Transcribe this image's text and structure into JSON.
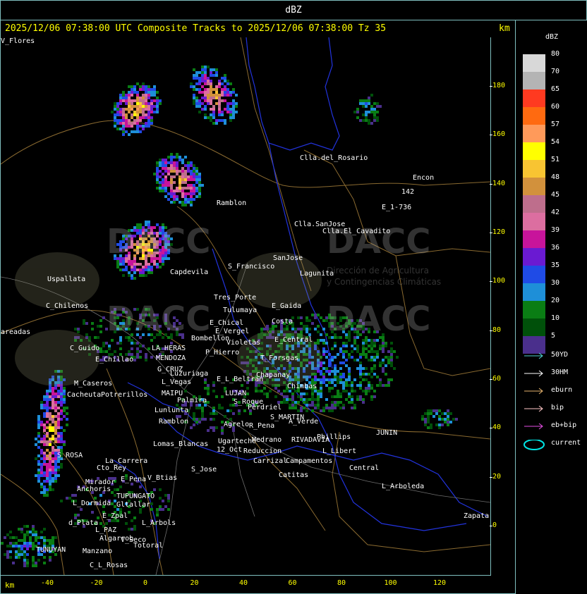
{
  "window_title": "dBZ",
  "header": {
    "info": "2025/12/06 07:38:00 UTC Composite Tracks to 2025/12/06 07:38:00 Tz 35",
    "km_label": "km"
  },
  "legend": {
    "title": "dBZ",
    "entries": [
      {
        "label": "80",
        "color": "#d8d8d8"
      },
      {
        "label": "70",
        "color": "#b4b4b4"
      },
      {
        "label": "65",
        "color": "#ff3a20"
      },
      {
        "label": "60",
        "color": "#ff6a10"
      },
      {
        "label": "57",
        "color": "#ff9a5a"
      },
      {
        "label": "54",
        "color": "#ffff00"
      },
      {
        "label": "51",
        "color": "#f8c432"
      },
      {
        "label": "48",
        "color": "#d2913c"
      },
      {
        "label": "45",
        "color": "#be6e8c"
      },
      {
        "label": "42",
        "color": "#dc6ea0"
      },
      {
        "label": "39",
        "color": "#c8149b"
      },
      {
        "label": "36",
        "color": "#6a1ad2"
      },
      {
        "label": "35",
        "color": "#1f4be6"
      },
      {
        "label": "30",
        "color": "#1e8fd8"
      },
      {
        "label": "20",
        "color": "#0a7d14"
      },
      {
        "label": "10",
        "color": "#00500a"
      },
      {
        "label": "5",
        "color": "#4a2f8c"
      }
    ],
    "tracks": [
      {
        "label": "50YD",
        "color": "#4fd2d2"
      },
      {
        "label": "30HM",
        "color": "#ffffff"
      },
      {
        "label": "eburn",
        "color": "#e6b46e"
      },
      {
        "label": "bip",
        "color": "#ffc8c8"
      },
      {
        "label": "eb+bip",
        "color": "#e650e6"
      },
      {
        "label": "current",
        "color": "#00e6e6"
      }
    ]
  },
  "axes": {
    "y_ticks": [
      "180",
      "160",
      "140",
      "120",
      "100",
      "80",
      "60",
      "40",
      "20",
      "0"
    ],
    "x_ticks": [
      "-40",
      "-20",
      "0",
      "20",
      "40",
      "60",
      "80",
      "100",
      "120"
    ],
    "x_unit": "km"
  },
  "places": [
    "Clla.del_Rosario",
    "Encon",
    "142",
    "E_1-736",
    "Ramblon",
    "Clla.SanJose",
    "Clla.El_Cavadito",
    "SanJose",
    "S_Francisco",
    "Lagunita",
    "Uspallata",
    "Capdevila",
    "Tres_Porte",
    "Tulumaya",
    "E_Gaida",
    "C_Chilenos",
    "E_Chical",
    "E_Vergel",
    "Costa",
    "areadas",
    "Bombellon",
    "Violetas",
    "P_Hierro",
    "E_Central",
    "T_Forsgas",
    "C_Guido",
    "E_Chillao",
    "LA_HERAS",
    "MENDOZA",
    "G_CRUZ",
    "Luzuriaga",
    "E_L_Beltran",
    "Chapanay",
    "Chimbas",
    "M_Caseros",
    "Potrerillos",
    "Cacheuta",
    "L_Vegas",
    "MAIPU",
    "LUJAN",
    "S_Roque",
    "Palmira",
    "Lunlunta",
    "Perdriel",
    "S_MARTIN",
    "A_Verde",
    "Ramblon",
    "Agrelo",
    "R_Pena",
    "JUNIN",
    "Lomas_Blancas",
    "Ugarteche",
    "Medrano",
    "RIVADAVIA",
    "Phillips",
    "12_Oct",
    "Reduccion",
    "L_Libert",
    "S_ROSA",
    "La_Carrera",
    "Cto_Rey",
    "S_Jose",
    "Carrizal",
    "Campamentos",
    "Central",
    "Catitas",
    "Mirador",
    "E_Pena",
    "V_Btias",
    "Anchoris",
    "TUPUNGATO",
    "L_Arboleda",
    "L_Dormida",
    "Gltallar",
    "E_Zpal",
    "d_Plata",
    "L_Arbols",
    "Zapata",
    "L_PAZ",
    "Algarrob",
    "V_Seco",
    "Totoral",
    "TUNUYAN",
    "Manzano",
    "C_L_Rosas",
    "V_Flores"
  ],
  "watermark": {
    "logo_text": "DACC",
    "subtitle_1": "Dirección de Agricultura",
    "subtitle_2": "y Contingencias Climáticas"
  }
}
